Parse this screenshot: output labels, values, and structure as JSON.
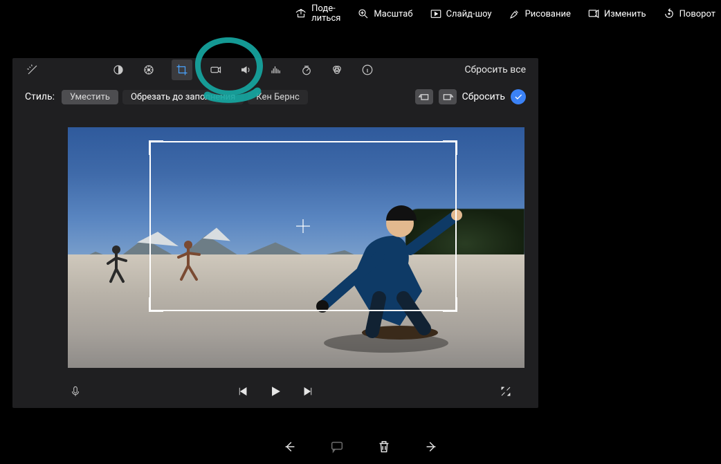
{
  "sysbar": {
    "share": "Поде-\nлиться",
    "zoom": "Масштаб",
    "slideshow": "Слайд-шоу",
    "draw": "Рисование",
    "edit": "Изменить",
    "rotate": "Поворот"
  },
  "inspector": {
    "reset_all": "Сбросить все"
  },
  "style_row": {
    "label": "Стиль:",
    "fit": "Уместить",
    "crop_to_fill": "Обрезать до заполнения",
    "ken_burns": "Кен Бернс",
    "reset": "Сбросить"
  }
}
